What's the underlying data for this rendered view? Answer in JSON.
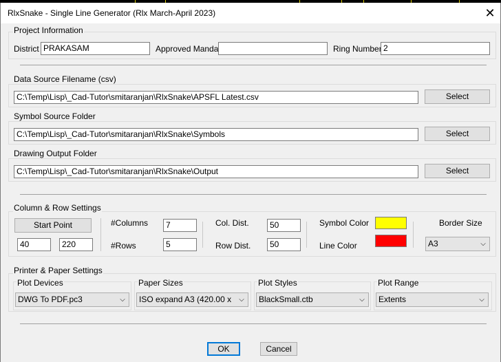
{
  "window": {
    "title": "RlxSnake - Single Line Generator (Rlx March-April 2023)",
    "close_glyph": "✕"
  },
  "project": {
    "group_label": "Project Information",
    "district_label": "District",
    "district_value": "PRAKASAM",
    "mandal_label": "Approved Mandal",
    "mandal_value": "",
    "ring_label": "Ring Number",
    "ring_value": "2"
  },
  "data_source": {
    "group_label": "Data Source Filename (csv)",
    "path": "C:\\Temp\\Lisp\\_Cad-Tutor\\smitaranjan\\RlxSnake\\APSFL Latest.csv",
    "select_label": "Select"
  },
  "symbol_source": {
    "group_label": "Symbol Source Folder",
    "path": "C:\\Temp\\Lisp\\_Cad-Tutor\\smitaranjan\\RlxSnake\\Symbols",
    "select_label": "Select"
  },
  "drawing_output": {
    "group_label": "Drawing Output Folder",
    "path": "C:\\Temp\\Lisp\\_Cad-Tutor\\smitaranjan\\RlxSnake\\Output",
    "select_label": "Select"
  },
  "colrow": {
    "group_label": "Column & Row Settings",
    "start_point_label": "Start Point",
    "start_x": "40",
    "start_y": "220",
    "columns_label": "#Columns",
    "columns_value": "7",
    "rows_label": "#Rows",
    "rows_value": "5",
    "col_dist_label": "Col. Dist.",
    "col_dist_value": "50",
    "row_dist_label": "Row Dist.",
    "row_dist_value": "50",
    "symbol_color_label": "Symbol Color",
    "symbol_color": "#ffff00",
    "line_color_label": "Line Color",
    "line_color": "#ff0000",
    "border_size_label": "Border Size",
    "border_size_value": "A3"
  },
  "printer": {
    "group_label": "Printer & Paper Settings",
    "plot_devices_label": "Plot Devices",
    "plot_devices_value": "DWG To PDF.pc3",
    "paper_sizes_label": "Paper Sizes",
    "paper_sizes_value": "ISO expand A3 (420.00 x 297",
    "plot_styles_label": "Plot Styles",
    "plot_styles_value": "BlackSmall.ctb",
    "plot_range_label": "Plot Range",
    "plot_range_value": "Extents"
  },
  "buttons": {
    "ok_label": "OK",
    "cancel_label": "Cancel"
  }
}
